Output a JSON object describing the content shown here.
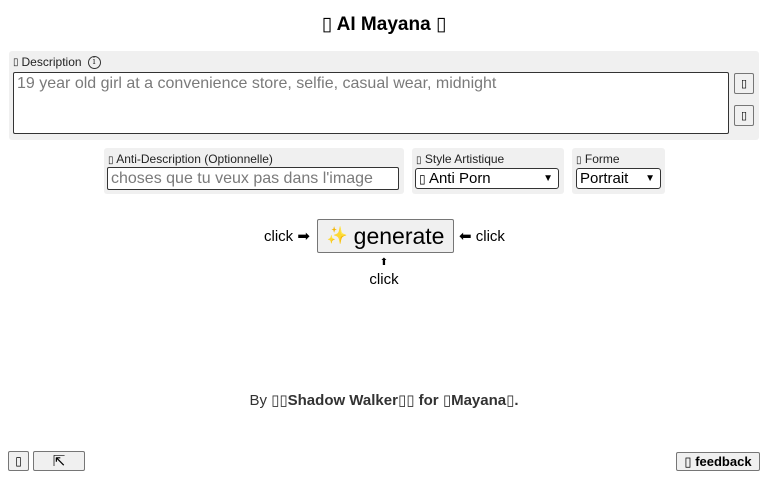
{
  "header": {
    "title": "AI Mayana",
    "left_glyph": "▯",
    "right_glyph": "▯"
  },
  "description": {
    "glyph": "▯",
    "label": "Description",
    "info_icon": "info-circle-icon",
    "info_glyph": "i",
    "placeholder": "19 year old girl at a convenience store, selfie, casual wear, midnight",
    "value": "",
    "side_button_1": "▯",
    "side_button_2": "▯"
  },
  "anti_description": {
    "glyph": "▯",
    "label": "Anti-Description (Optionnelle)",
    "placeholder": "choses que tu veux pas dans l'image",
    "value": ""
  },
  "style": {
    "glyph": "▯",
    "label": "Style Artistique",
    "selected_glyph": "▯",
    "selected": "Anti Porn"
  },
  "forme": {
    "glyph": "▯",
    "label": "Forme",
    "selected": "Portrait"
  },
  "generate": {
    "left_text": "click ➡",
    "icon": "sparkles-icon",
    "icon_glyph": "✨",
    "label": "generate",
    "right_text": "⬅ click",
    "up_arrow": "⬆",
    "below_text": "click"
  },
  "credits": {
    "prefix": "By",
    "glyph1": "▯▯",
    "author": "Shadow Walker",
    "glyph2": "▯▯",
    "for": "for",
    "glyph3": "▯",
    "app": "Mayana",
    "glyph4": "▯",
    "end": "."
  },
  "bottom": {
    "btn1": "▯",
    "btn2": "⇱",
    "feedback_glyph": "▯",
    "feedback": "feedback"
  }
}
